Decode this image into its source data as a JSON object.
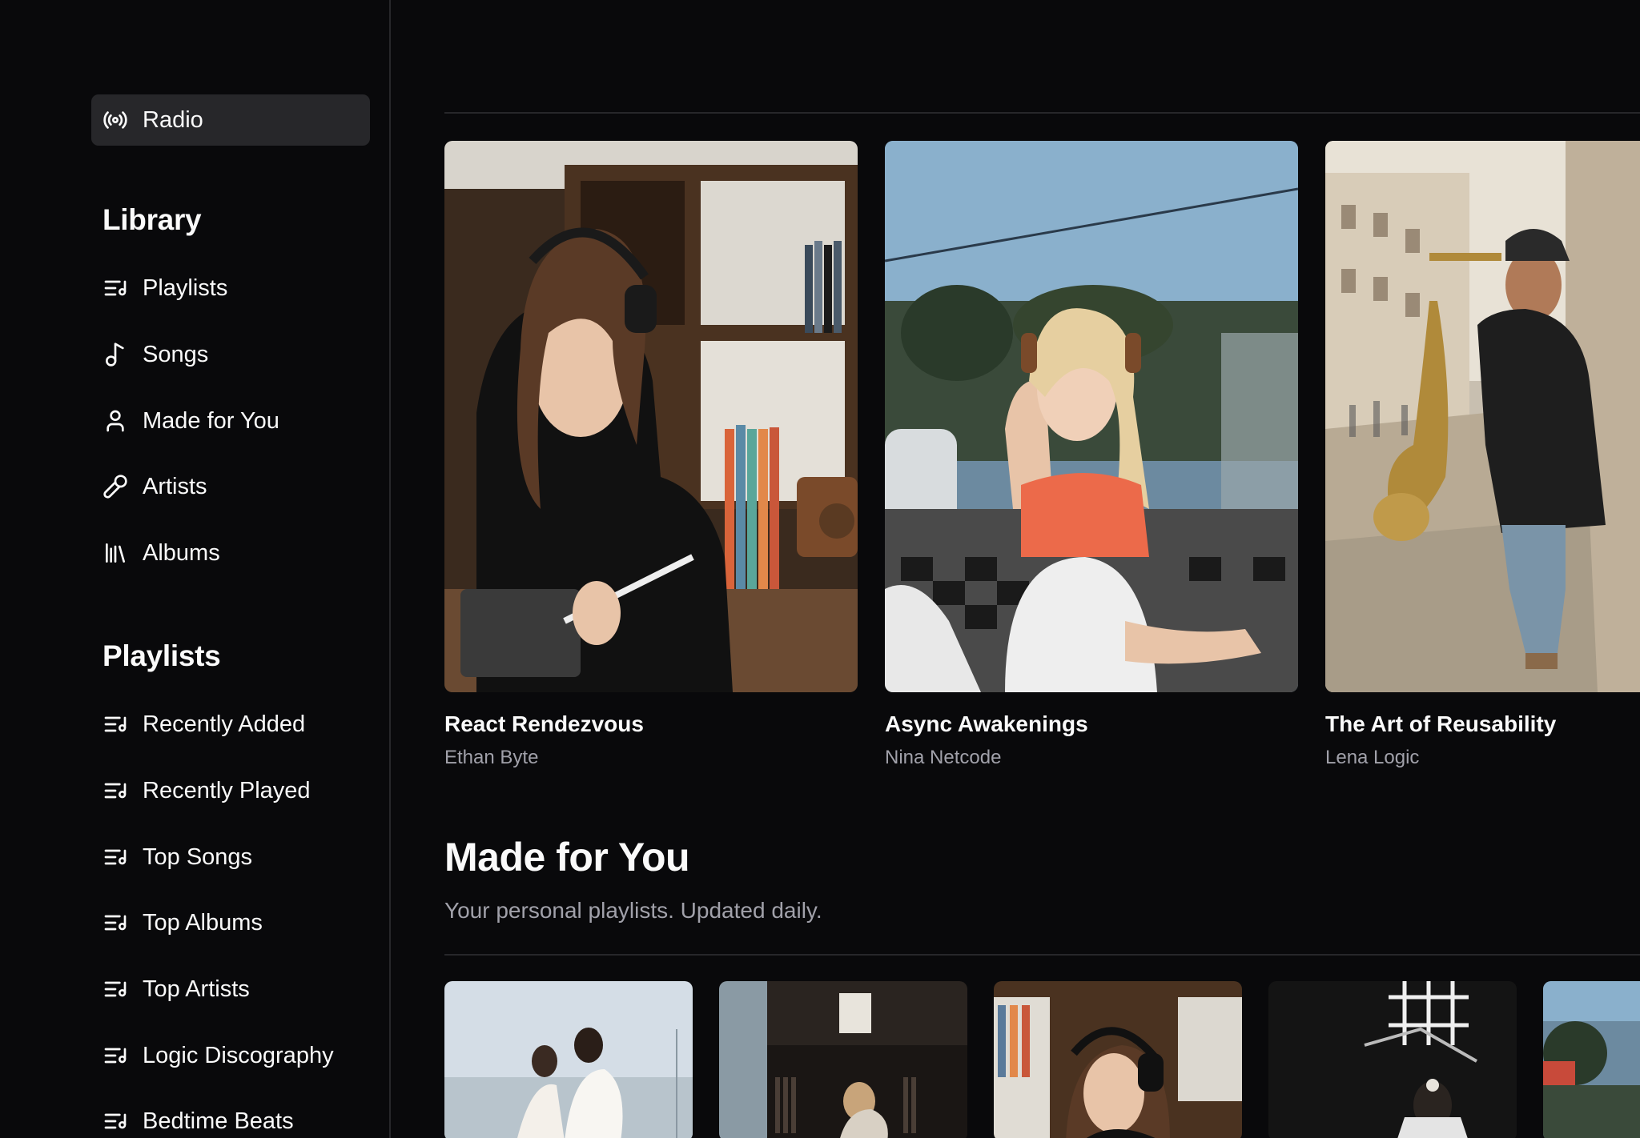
{
  "sidebar": {
    "discover": {
      "radio": {
        "label": "Radio",
        "icon": "radio-icon"
      }
    },
    "library": {
      "title": "Library",
      "items": [
        {
          "label": "Playlists",
          "icon": "playlist-icon"
        },
        {
          "label": "Songs",
          "icon": "music-note-icon"
        },
        {
          "label": "Made for You",
          "icon": "user-icon"
        },
        {
          "label": "Artists",
          "icon": "microphone-icon"
        },
        {
          "label": "Albums",
          "icon": "library-icon"
        }
      ]
    },
    "playlists": {
      "title": "Playlists",
      "items": [
        {
          "label": "Recently Added",
          "icon": "playlist-icon"
        },
        {
          "label": "Recently Played",
          "icon": "playlist-icon"
        },
        {
          "label": "Top Songs",
          "icon": "playlist-icon"
        },
        {
          "label": "Top Albums",
          "icon": "playlist-icon"
        },
        {
          "label": "Top Artists",
          "icon": "playlist-icon"
        },
        {
          "label": "Logic Discography",
          "icon": "playlist-icon"
        },
        {
          "label": "Bedtime Beats",
          "icon": "playlist-icon"
        }
      ]
    }
  },
  "listen_now": {
    "albums": [
      {
        "title": "React Rendezvous",
        "artist": "Ethan Byte"
      },
      {
        "title": "Async Awakenings",
        "artist": "Nina Netcode"
      },
      {
        "title": "The Art of Reusability",
        "artist": "Lena Logic"
      }
    ]
  },
  "made_for_you": {
    "title": "Made for You",
    "subtitle": "Your personal playlists. Updated daily."
  },
  "colors": {
    "background": "#09090b",
    "active_item": "#27272a",
    "muted_text": "#a1a1aa",
    "divider": "#27272a"
  }
}
